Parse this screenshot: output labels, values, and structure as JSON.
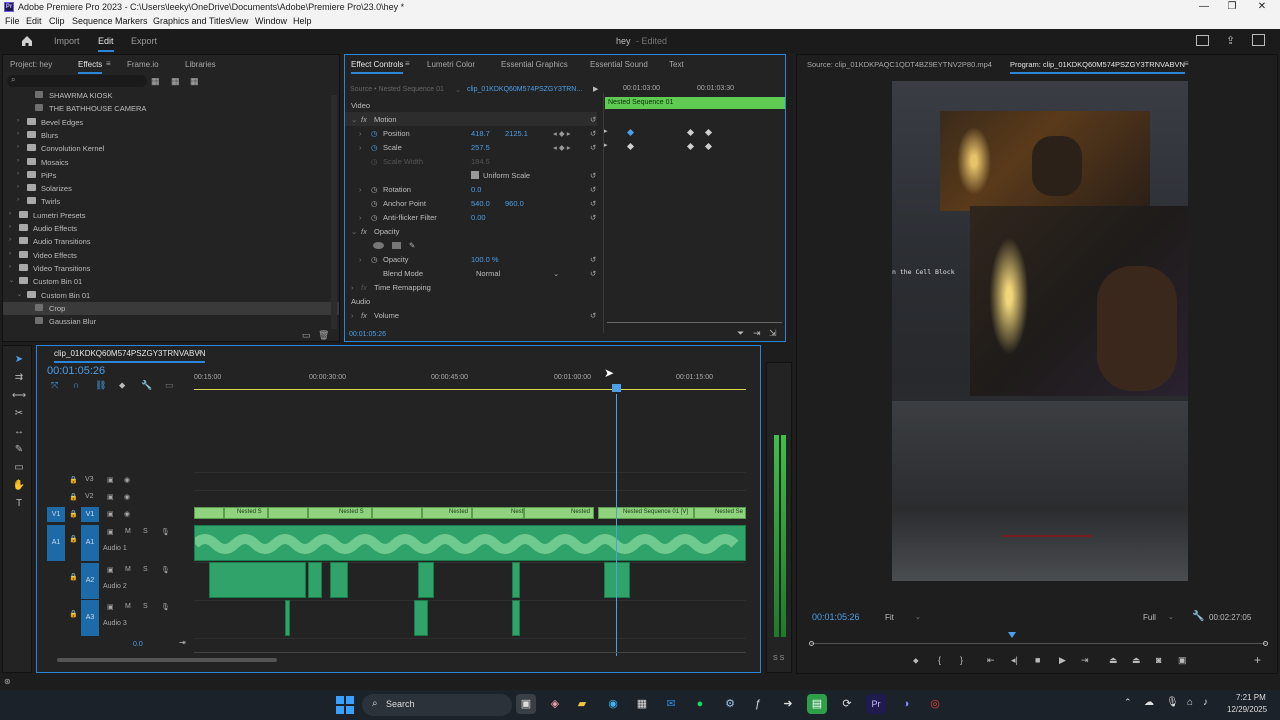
{
  "window": {
    "title": "Adobe Premiere Pro 2023 - C:\\Users\\leeky\\OneDrive\\Documents\\Adobe\\Premiere Pro\\23.0\\hey *",
    "minimize": "—",
    "maximize": "❐",
    "close": "✕"
  },
  "menu": [
    "File",
    "Edit",
    "Clip",
    "Sequence",
    "Markers",
    "Graphics and Titles",
    "View",
    "Window",
    "Help"
  ],
  "workspace": {
    "tabs": [
      "Import",
      "Edit",
      "Export"
    ],
    "active": "Edit",
    "project_name": "hey",
    "project_status": "- Edited"
  },
  "effects_panel": {
    "tabs": [
      "Project: hey",
      "Effects",
      "Frame.io",
      "Libraries"
    ],
    "items": [
      {
        "label": "SHAWRMA KIOSK",
        "indent": 3,
        "caret": ""
      },
      {
        "label": "THE BATHHOUSE CAMERA",
        "indent": 3,
        "caret": ""
      },
      {
        "label": "Bevel Edges",
        "indent": 2,
        "caret": "›"
      },
      {
        "label": "Blurs",
        "indent": 2,
        "caret": "›"
      },
      {
        "label": "Convolution Kernel",
        "indent": 2,
        "caret": "›"
      },
      {
        "label": "Mosaics",
        "indent": 2,
        "caret": "›"
      },
      {
        "label": "PiPs",
        "indent": 2,
        "caret": "›"
      },
      {
        "label": "Solarizes",
        "indent": 2,
        "caret": "›"
      },
      {
        "label": "Twirls",
        "indent": 2,
        "caret": "›"
      },
      {
        "label": "Lumetri Presets",
        "indent": 1,
        "caret": "›"
      },
      {
        "label": "Audio Effects",
        "indent": 1,
        "caret": "›"
      },
      {
        "label": "Audio Transitions",
        "indent": 1,
        "caret": "›"
      },
      {
        "label": "Video Effects",
        "indent": 1,
        "caret": "›"
      },
      {
        "label": "Video Transitions",
        "indent": 1,
        "caret": "›"
      },
      {
        "label": "Custom Bin 01",
        "indent": 1,
        "caret": "⌄"
      },
      {
        "label": "Custom Bin 01",
        "indent": 2,
        "caret": "⌄"
      },
      {
        "label": "Crop",
        "indent": 3,
        "caret": ""
      },
      {
        "label": "Gaussian Blur",
        "indent": 3,
        "caret": ""
      }
    ]
  },
  "effect_controls": {
    "tabs": [
      "Effect Controls",
      "Lumetri Color",
      "Essential Graphics",
      "Essential Sound",
      "Text"
    ],
    "source": "Source • Nested Sequence 01",
    "clip": "clip_01KDKQ60M574PSZGY3TRN...",
    "time_a": "00:01:03:00",
    "time_b": "00:01:03:30",
    "clip_bar": "Nested Sequence 01",
    "video_header": "Video",
    "motion": "Motion",
    "position_label": "Position",
    "position_x": "418.7",
    "position_y": "2125.1",
    "scale_label": "Scale",
    "scale": "257.5",
    "scale_width_label": "Scale Width",
    "scale_width": "184.5",
    "uniform_scale": "Uniform Scale",
    "rotation_label": "Rotation",
    "rotation": "0.0",
    "anchor_label": "Anchor Point",
    "anchor_x": "540.0",
    "anchor_y": "960.0",
    "antiflicker_label": "Anti-flicker Filter",
    "antiflicker": "0.00",
    "opacity_header": "Opacity",
    "opacity_label": "Opacity",
    "opacity": "100.0 %",
    "blend_label": "Blend Mode",
    "blend": "Normal",
    "time_remap": "Time Remapping",
    "audio_header": "Audio",
    "volume": "Volume",
    "timecode": "00:01:05:26"
  },
  "source_monitor": {
    "source_tab": "Source: clip_01KDKPAQC1QDT4BZ9EYTNV2P80.mp4",
    "program_tab": "Program: clip_01KDKQ60M574PSZGY3TRNVABVN",
    "overlay_text": "n the Cell Block",
    "timecode": "00:01:05:26",
    "fit": "Fit",
    "quality": "Full",
    "duration": "00:02:27:05"
  },
  "timeline": {
    "tab": "clip_01KDKQ60M574PSZGY3TRNVABVN",
    "timecode": "00:01:05:26",
    "ruler": [
      "00:15:00",
      "00:00:30:00",
      "00:00:45:00",
      "00:01:00:00",
      "00:01:15:00"
    ],
    "tracks": [
      {
        "id": "V3",
        "type": "video"
      },
      {
        "id": "V2",
        "type": "video"
      },
      {
        "id": "V1",
        "type": "video",
        "target": "V1"
      },
      {
        "id": "A1",
        "type": "audio",
        "name": "Audio 1",
        "target": "A1"
      },
      {
        "id": "A2",
        "type": "audio",
        "name": "Audio 2"
      },
      {
        "id": "A3",
        "type": "audio",
        "name": "Audio 3"
      }
    ],
    "v1_clips": [
      "Nested S",
      "Nested S",
      "Nested",
      "Nest",
      "Nested",
      "Nested Sequence 01 [V]",
      "Nested Se"
    ],
    "mix_value": "0.0",
    "meter_labels": "S S"
  },
  "taskbar": {
    "search": "Search",
    "time": "7:21 PM",
    "date": "12/29/2025"
  },
  "colors": {
    "accent": "#2b86d9",
    "clip_video": "#8fd37e",
    "clip_audio": "#2fa36a",
    "nested_bar": "#5fcb52"
  }
}
